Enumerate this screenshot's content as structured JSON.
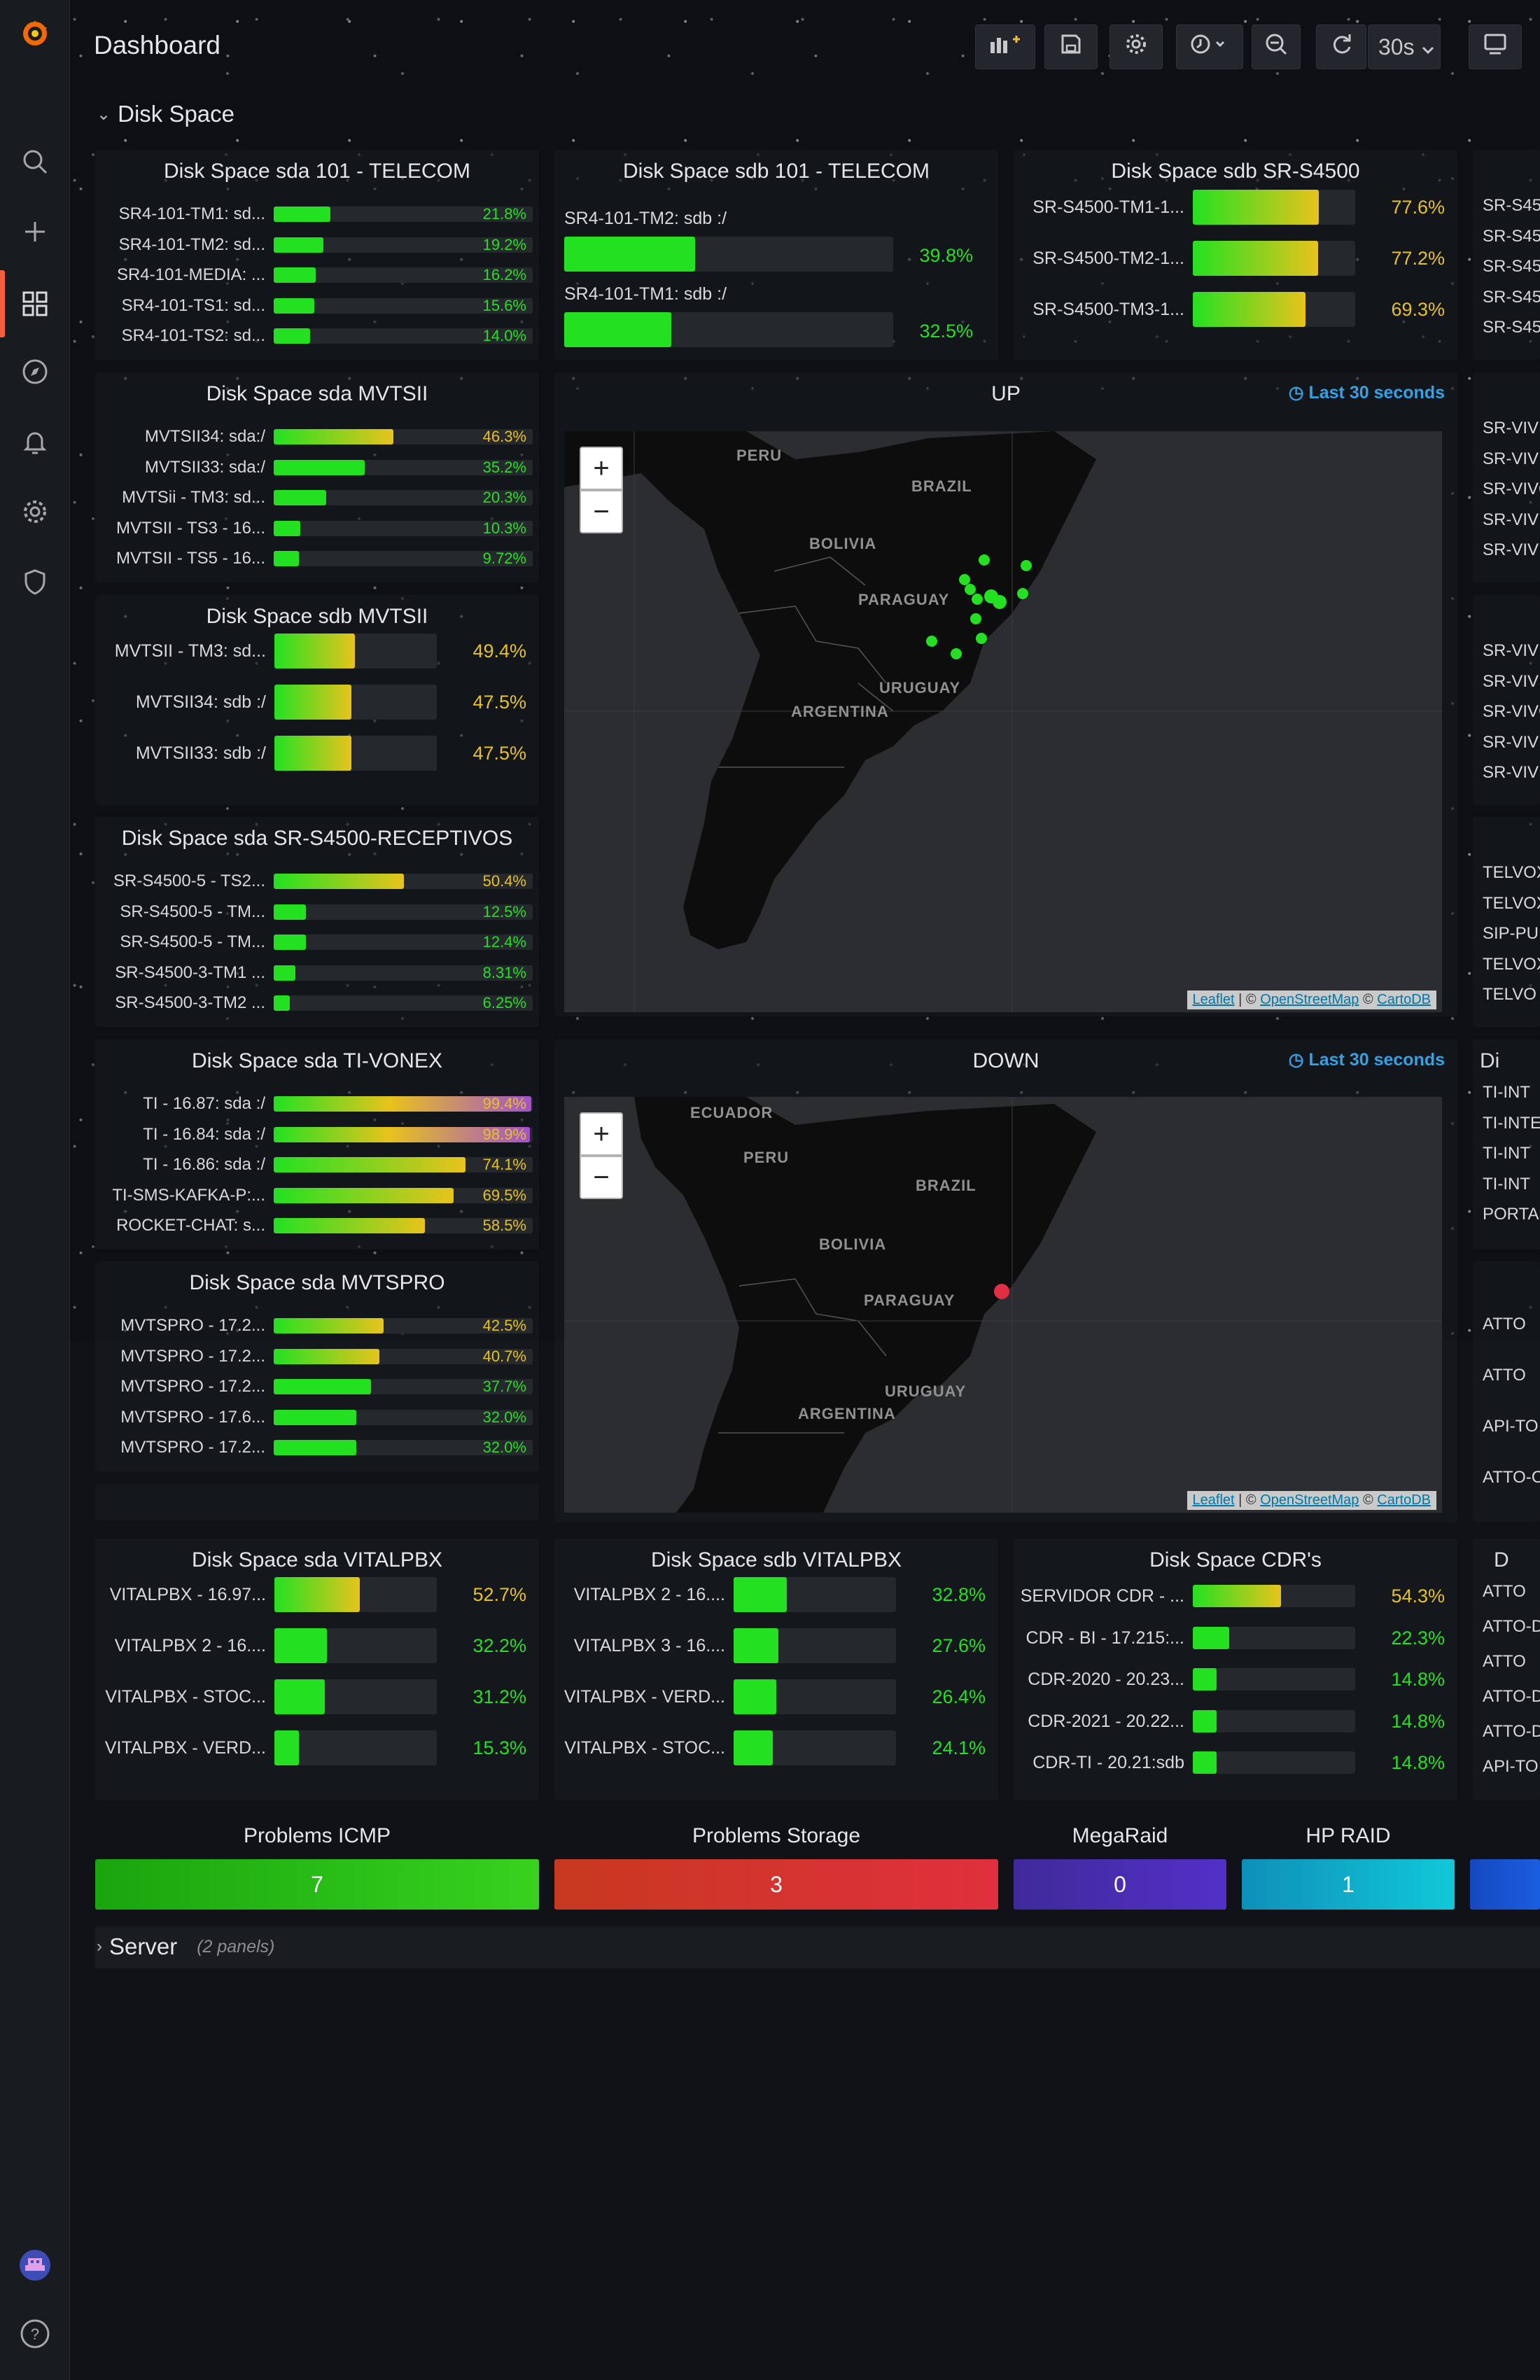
{
  "topbar": {
    "title": "Dashboard",
    "refresh": "30s"
  },
  "sidebar": {
    "icons": [
      "grafana-logo-icon",
      "search-icon",
      "plus-icon",
      "dashboards-icon",
      "explore-icon",
      "alerting-icon",
      "config-icon",
      "shield-icon",
      "user-avatar-icon",
      "help-icon"
    ]
  },
  "rows": {
    "disk_space": "Disk Space",
    "server": "Server",
    "server_count": "(2 panels)"
  },
  "colors": {
    "green": "#23e121",
    "yellow": "#e8c31c",
    "red": "#e02f44",
    "purple": "#a352cc",
    "blue": "#33a2e5"
  },
  "panels": {
    "p1": {
      "title": "Disk Space sda 101 - TELECOM",
      "items": [
        {
          "label": "SR4-101-TM1: sd...",
          "value": "21.8%",
          "pct": 21.8
        },
        {
          "label": "SR4-101-TM2: sd...",
          "value": "19.2%",
          "pct": 19.2
        },
        {
          "label": "SR4-101-MEDIA: ...",
          "value": "16.2%",
          "pct": 16.2
        },
        {
          "label": "SR4-101-TS1: sd...",
          "value": "15.6%",
          "pct": 15.6
        },
        {
          "label": "SR4-101-TS2: sd...",
          "value": "14.0%",
          "pct": 14.0
        }
      ]
    },
    "p2": {
      "title": "Disk Space sdb 101 - TELECOM",
      "items": [
        {
          "label": "SR4-101-TM2: sdb :/",
          "value": "39.8%",
          "pct": 39.8
        },
        {
          "label": "SR4-101-TM1: sdb :/",
          "value": "32.5%",
          "pct": 32.5
        }
      ]
    },
    "p3": {
      "title": "Disk Space sdb SR-S4500",
      "items": [
        {
          "label": "SR-S4500-TM1-1...",
          "value": "77.6%",
          "pct": 77.6
        },
        {
          "label": "SR-S4500-TM2-1...",
          "value": "77.2%",
          "pct": 77.2
        },
        {
          "label": "SR-S4500-TM3-1...",
          "value": "69.3%",
          "pct": 69.3
        }
      ]
    },
    "p4": {
      "title": "Disk Space sda MVTSII",
      "items": [
        {
          "label": "MVTSII34: sda:/",
          "value": "46.3%",
          "pct": 46.3
        },
        {
          "label": "MVTSII33: sda:/",
          "value": "35.2%",
          "pct": 35.2
        },
        {
          "label": "MVTSii - TM3: sd...",
          "value": "20.3%",
          "pct": 20.3
        },
        {
          "label": "MVTSII - TS3 - 16...",
          "value": "10.3%",
          "pct": 10.3
        },
        {
          "label": "MVTSII - TS5 - 16...",
          "value": "9.72%",
          "pct": 9.72
        }
      ]
    },
    "p5": {
      "title": "Disk Space sdb MVTSII",
      "items": [
        {
          "label": "MVTSII - TM3: sd...",
          "value": "49.4%",
          "pct": 49.4
        },
        {
          "label": "MVTSII34: sdb :/",
          "value": "47.5%",
          "pct": 47.5
        },
        {
          "label": "MVTSII33: sdb :/",
          "value": "47.5%",
          "pct": 47.5
        }
      ]
    },
    "p6": {
      "title": "Disk Space sda SR-S4500-RECEPTIVOS",
      "items": [
        {
          "label": "SR-S4500-5 - TS2...",
          "value": "50.4%",
          "pct": 50.4
        },
        {
          "label": "SR-S4500-5 - TM...",
          "value": "12.5%",
          "pct": 12.5
        },
        {
          "label": "SR-S4500-5 - TM...",
          "value": "12.4%",
          "pct": 12.4
        },
        {
          "label": "SR-S4500-3-TM1 ...",
          "value": "8.31%",
          "pct": 8.31
        },
        {
          "label": "SR-S4500-3-TM2 ...",
          "value": "6.25%",
          "pct": 6.25
        }
      ]
    },
    "p7": {
      "title": "Disk Space sda TI-VONEX",
      "items": [
        {
          "label": "TI - 16.87: sda :/",
          "value": "99.4%",
          "pct": 99.4
        },
        {
          "label": "TI - 16.84: sda :/",
          "value": "98.9%",
          "pct": 98.9
        },
        {
          "label": "TI - 16.86: sda :/",
          "value": "74.1%",
          "pct": 74.1
        },
        {
          "label": "TI-SMS-KAFKA-P:...",
          "value": "69.5%",
          "pct": 69.5
        },
        {
          "label": "ROCKET-CHAT: s...",
          "value": "58.5%",
          "pct": 58.5
        }
      ]
    },
    "p8": {
      "title": "Disk Space sda MVTSPRO",
      "items": [
        {
          "label": "MVTSPRO - 17.2...",
          "value": "42.5%",
          "pct": 42.5
        },
        {
          "label": "MVTSPRO - 17.2...",
          "value": "40.7%",
          "pct": 40.7
        },
        {
          "label": "MVTSPRO - 17.2...",
          "value": "37.7%",
          "pct": 37.7
        },
        {
          "label": "MVTSPRO - 17.6...",
          "value": "32.0%",
          "pct": 32.0
        },
        {
          "label": "MVTSPRO - 17.2...",
          "value": "32.0%",
          "pct": 32.0
        }
      ]
    },
    "p9": {
      "title": "Disk Space sda VITALPBX",
      "items": [
        {
          "label": "VITALPBX - 16.97...",
          "value": "52.7%",
          "pct": 52.7
        },
        {
          "label": "VITALPBX 2 - 16....",
          "value": "32.2%",
          "pct": 32.2
        },
        {
          "label": "VITALPBX - STOC...",
          "value": "31.2%",
          "pct": 31.2
        },
        {
          "label": "VITALPBX - VERD...",
          "value": "15.3%",
          "pct": 15.3
        }
      ]
    },
    "p10": {
      "title": "Disk Space sdb VITALPBX",
      "items": [
        {
          "label": "VITALPBX 2 - 16....",
          "value": "32.8%",
          "pct": 32.8
        },
        {
          "label": "VITALPBX 3 - 16....",
          "value": "27.6%",
          "pct": 27.6
        },
        {
          "label": "VITALPBX - VERD...",
          "value": "26.4%",
          "pct": 26.4
        },
        {
          "label": "VITALPBX - STOC...",
          "value": "24.1%",
          "pct": 24.1
        }
      ]
    },
    "p11": {
      "title": "Disk Space CDR's",
      "items": [
        {
          "label": "SERVIDOR CDR - ...",
          "value": "54.3%",
          "pct": 54.3
        },
        {
          "label": "CDR - BI - 17.215:...",
          "value": "22.3%",
          "pct": 22.3
        },
        {
          "label": "CDR-2020 - 20.23...",
          "value": "14.8%",
          "pct": 14.8
        },
        {
          "label": "CDR-2021 - 20.22...",
          "value": "14.8%",
          "pct": 14.8
        },
        {
          "label": "CDR-TI - 20.21:sdb",
          "value": "14.8%",
          "pct": 14.8
        }
      ]
    }
  },
  "maps": {
    "up": {
      "title": "UP",
      "time": "Last 30 seconds",
      "labels": [
        "PERU",
        "BRAZIL",
        "BOLIVIA",
        "PARAGUAY",
        "URUGUAY",
        "ARGENTINA"
      ]
    },
    "down": {
      "title": "DOWN",
      "time": "Last 30 seconds",
      "labels": [
        "ECUADOR",
        "PERU",
        "BRAZIL",
        "BOLIVIA",
        "PARAGUAY",
        "URUGUAY",
        "ARGENTINA"
      ]
    },
    "attr_leaflet": "Leaflet",
    "attr_sep1": "|",
    "attr_osm": "OpenStreetMap",
    "attr_carto": "CartoDB",
    "attr_c1": "©",
    "attr_c2": "©"
  },
  "stats": [
    {
      "title": "Problems ICMP",
      "value": "7"
    },
    {
      "title": "Problems Storage",
      "value": "3"
    },
    {
      "title": "MegaRaid",
      "value": "0"
    },
    {
      "title": "HP RAID",
      "value": "1"
    }
  ],
  "right_clip": {
    "g1": [
      "SR-S45",
      "SR-S45",
      "SR-S45",
      "SR-S45",
      "SR-S45"
    ],
    "g2": [
      "SR-VIV",
      "SR-VIV",
      "SR-VIVO",
      "SR-VIV",
      "SR-VIV"
    ],
    "g3": [
      "SR-VIV",
      "SR-VIV",
      "SR-VIVO",
      "SR-VIV",
      "SR-VIV"
    ],
    "g4": [
      "TELVOX",
      "TELVOX",
      "SIP-PU",
      "TELVOX",
      "TELVO"
    ],
    "g5_title": "Di",
    "g5": [
      "TI-INT",
      "TI-INTE",
      "TI-INT",
      "TI-INT",
      "PORTAL"
    ],
    "g6": [
      "ATTO",
      "ATTO",
      "API-TO",
      "ATTO-C"
    ],
    "g7_title": "D",
    "g7": [
      "ATTO",
      "ATTO-D",
      "ATTO",
      "ATTO-D",
      "ATTO-D",
      "API-TO"
    ]
  }
}
